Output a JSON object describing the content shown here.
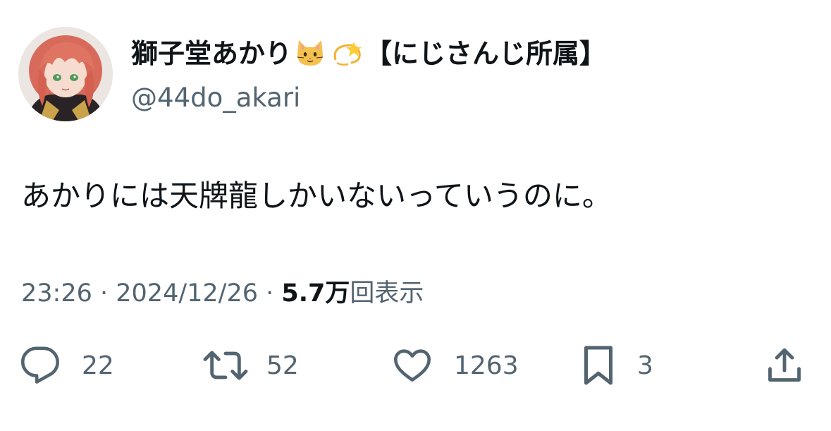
{
  "author": {
    "display_name": "獅子堂あかり",
    "name_emojis": [
      "cat-face-emoji",
      "dizzy-emoji"
    ],
    "affiliation": "【にじさんじ所属】",
    "handle": "@44do_akari"
  },
  "tweet": {
    "text": "あかりには天牌龍しかいないっていうのに。"
  },
  "meta": {
    "time": "23:26",
    "separator": " · ",
    "date": "2024/12/26",
    "views_count": "5.7万",
    "views_label": "回表示"
  },
  "actions": {
    "reply_count": "22",
    "retweet_count": "52",
    "like_count": "1263",
    "bookmark_count": "3"
  },
  "icons": {
    "reply": "reply-icon",
    "retweet": "retweet-icon",
    "like": "heart-icon",
    "bookmark": "bookmark-icon",
    "share": "share-icon"
  },
  "colors": {
    "text_primary": "#0f1419",
    "text_secondary": "#536471"
  }
}
